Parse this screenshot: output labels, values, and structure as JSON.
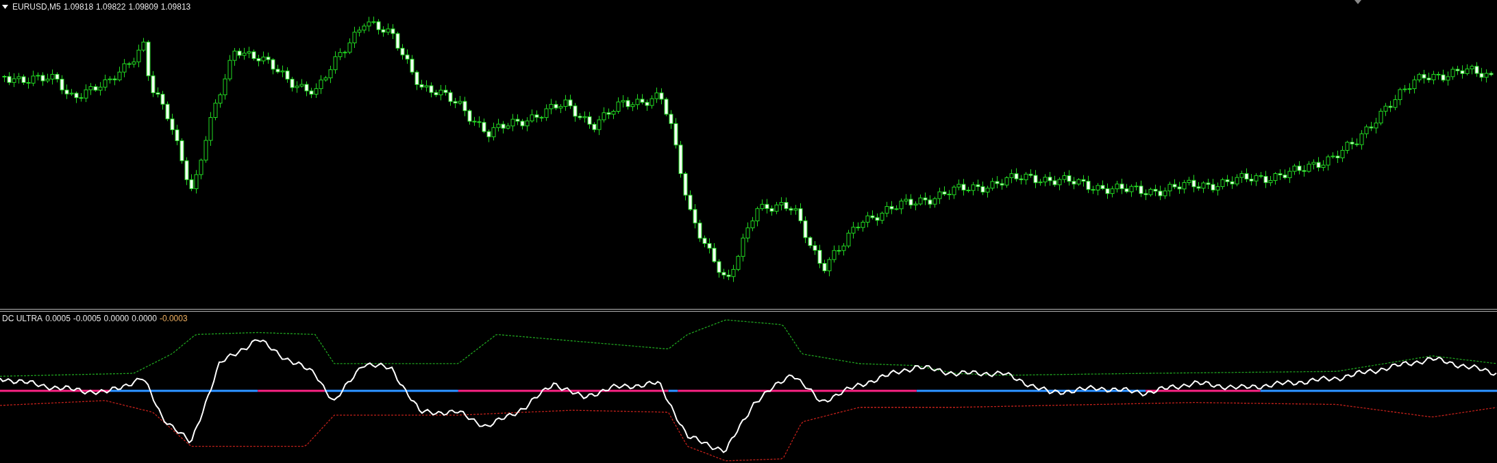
{
  "main_chart": {
    "symbol": "EURUSD,M5",
    "values": [
      "1.09818",
      "1.09822",
      "1.09809",
      "1.09813"
    ]
  },
  "indicator": {
    "name": "DC ULTRA",
    "values": [
      {
        "text": "0.0005",
        "color": "#e6e6e6"
      },
      {
        "text": "-0.0005",
        "color": "#e6e6e6"
      },
      {
        "text": "0.0000",
        "color": "#e6e6e6"
      },
      {
        "text": "0.0000",
        "color": "#e6e6e6"
      },
      {
        "text": "-0.0003",
        "color": "#f0b060"
      }
    ]
  }
}
